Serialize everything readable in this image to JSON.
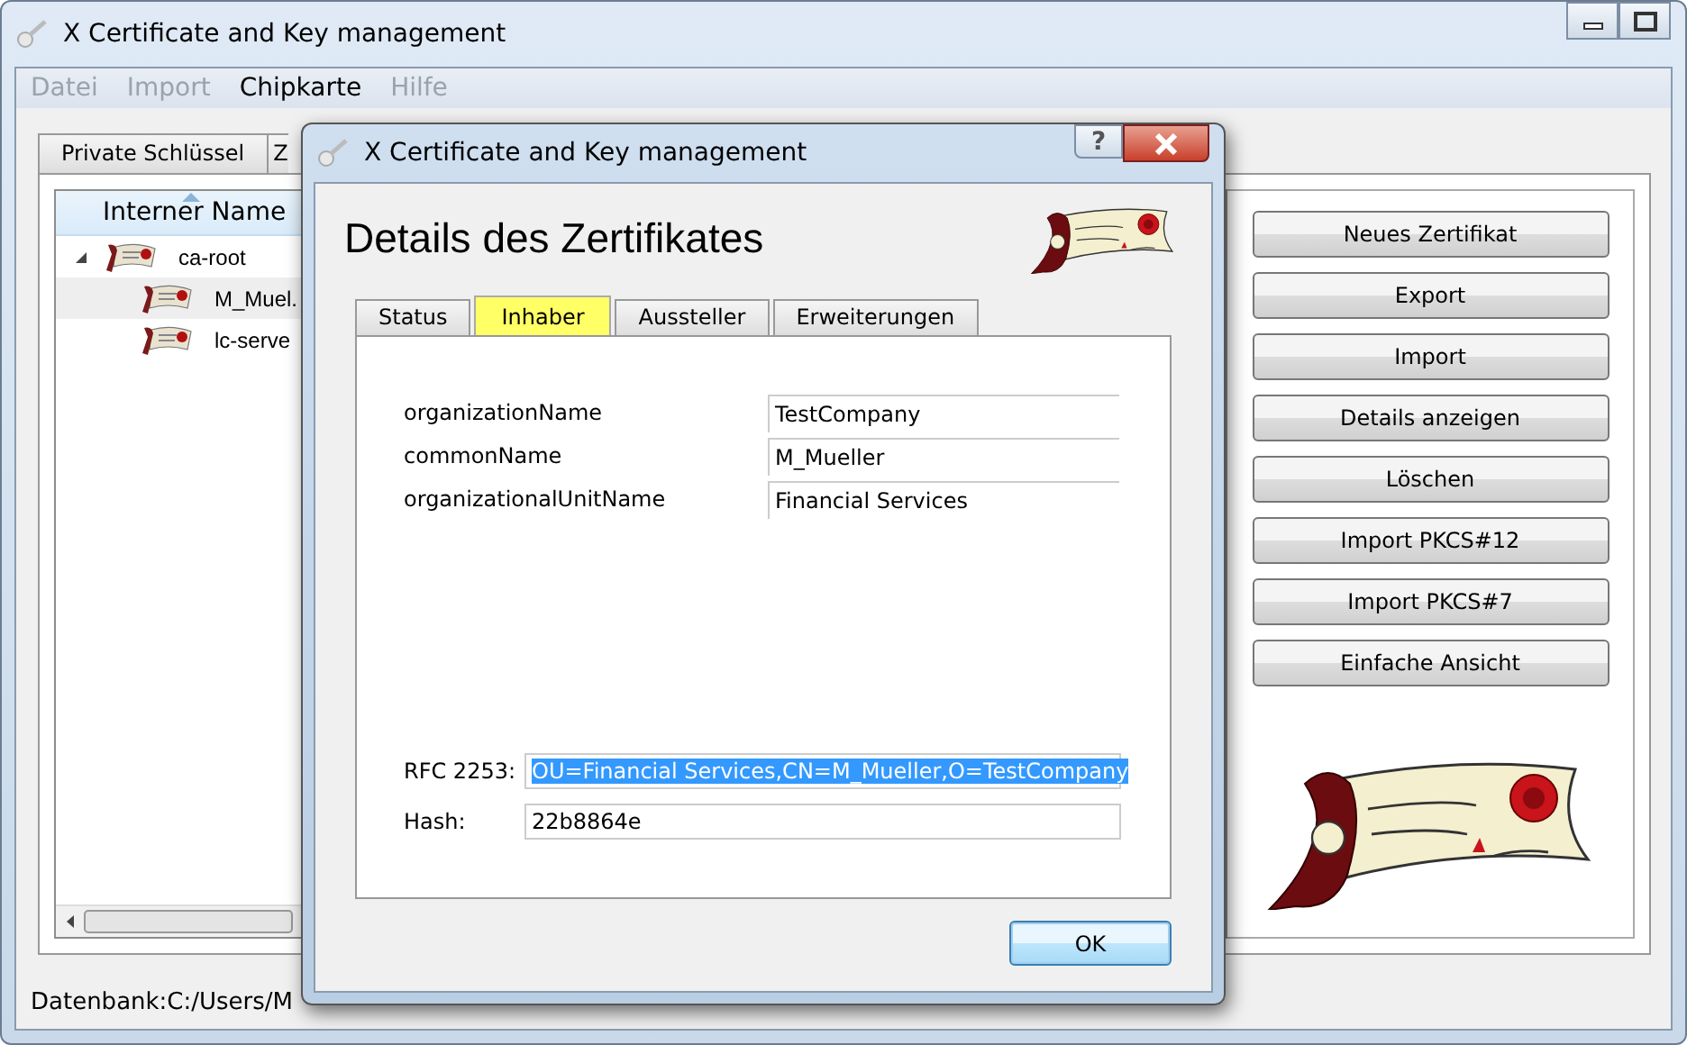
{
  "window": {
    "title": "X Certificate and Key management"
  },
  "menu": [
    {
      "label": "Datei",
      "disabled": true
    },
    {
      "label": "Import",
      "disabled": true
    },
    {
      "label": "Chipkarte",
      "disabled": false
    },
    {
      "label": "Hilfe",
      "disabled": true
    }
  ],
  "tabs": [
    {
      "label": "Private Schlüssel",
      "selected": false
    },
    {
      "label": "Z",
      "selected": false
    }
  ],
  "tree": {
    "column": "Interner Name",
    "items": [
      {
        "label": "ca-root",
        "expanded": true,
        "selected": false,
        "children": [
          {
            "label": "M_Muel.",
            "selected": true
          },
          {
            "label": "lc-serve",
            "selected": false
          }
        ]
      }
    ]
  },
  "buttons": [
    "Neues Zertifikat",
    "Export",
    "Import",
    "Details anzeigen",
    "Löschen",
    "Import PKCS#12",
    "Import PKCS#7",
    "Einfache Ansicht"
  ],
  "status_bar": "Datenbank:C:/Users/M",
  "dialog": {
    "title": "X Certificate and Key management",
    "help_button": "?",
    "heading": "Details des Zertifikates",
    "tabs": [
      {
        "label": "Status",
        "selected": false
      },
      {
        "label": "Inhaber",
        "selected": true
      },
      {
        "label": "Aussteller",
        "selected": false
      },
      {
        "label": "Erweiterungen",
        "selected": false
      }
    ],
    "fields": [
      {
        "label": "organizationName",
        "value": "TestCompany"
      },
      {
        "label": "commonName",
        "value": "M_Mueller"
      },
      {
        "label": "organizationalUnitName",
        "value": "Financial Services"
      }
    ],
    "rfc": {
      "label": "RFC 2253:",
      "value": "OU=Financial Services,CN=M_Mueller,O=TestCompany",
      "text_selected": true
    },
    "hash": {
      "label": "Hash:",
      "value": "22b8864e"
    },
    "ok": "OK"
  }
}
